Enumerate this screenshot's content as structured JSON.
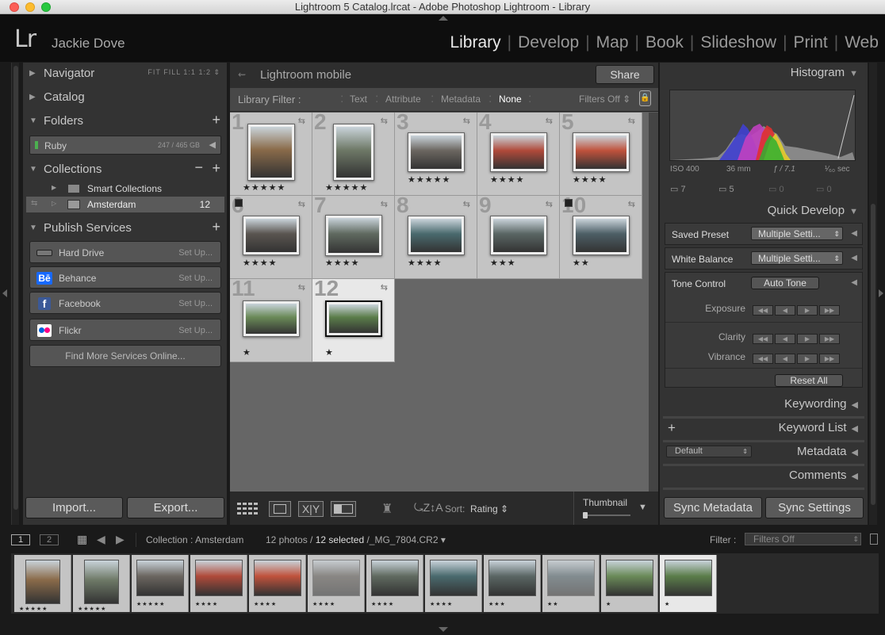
{
  "window": {
    "title": "Lightroom 5 Catalog.lrcat - Adobe Photoshop Lightroom - Library"
  },
  "identity": {
    "logo": "Lr",
    "user": "Jackie Dove"
  },
  "modules": [
    "Library",
    "Develop",
    "Map",
    "Book",
    "Slideshow",
    "Print",
    "Web"
  ],
  "left": {
    "navigator": {
      "label": "Navigator",
      "zoom": [
        "FIT",
        "FILL",
        "1:1",
        "1:2"
      ]
    },
    "catalog": {
      "label": "Catalog"
    },
    "folders": {
      "label": "Folders",
      "volume": {
        "name": "Ruby",
        "size": "247 / 465 GB"
      }
    },
    "collections": {
      "label": "Collections",
      "items": [
        {
          "name": "Smart Collections",
          "count": ""
        },
        {
          "name": "Amsterdam",
          "count": "12"
        }
      ]
    },
    "publish": {
      "label": "Publish Services",
      "services": [
        {
          "name": "Hard Drive",
          "action": "Set Up..."
        },
        {
          "name": "Behance",
          "action": "Set Up..."
        },
        {
          "name": "Facebook",
          "action": "Set Up..."
        },
        {
          "name": "Flickr",
          "action": "Set Up..."
        }
      ],
      "find_more": "Find More Services Online..."
    },
    "import_label": "Import...",
    "export_label": "Export..."
  },
  "center": {
    "mobile_label": "Lightroom mobile",
    "share_label": "Share",
    "filter": {
      "label": "Library Filter :",
      "options": [
        "Text",
        "Attribute",
        "Metadata",
        "None"
      ],
      "active": "None",
      "filters_off": "Filters Off"
    },
    "photos": [
      {
        "num": "1",
        "stars": "★★★★★",
        "color": "#8a6b4a"
      },
      {
        "num": "2",
        "stars": "★★★★★",
        "color": "#6f7a68"
      },
      {
        "num": "3",
        "stars": "★★★★★",
        "color": "#6b6660"
      },
      {
        "num": "4",
        "stars": "★★★★",
        "color": "#b04a3a"
      },
      {
        "num": "5",
        "stars": "★★★★",
        "color": "#c0523c"
      },
      {
        "num": "6",
        "stars": "★★★★",
        "color": "#5a5550"
      },
      {
        "num": "7",
        "stars": "★★★★",
        "color": "#606a60"
      },
      {
        "num": "8",
        "stars": "★★★★",
        "color": "#4a6a6e"
      },
      {
        "num": "9",
        "stars": "★★★",
        "color": "#5a6664"
      },
      {
        "num": "10",
        "stars": "★★",
        "color": "#4d5f66"
      },
      {
        "num": "11",
        "stars": "★",
        "color": "#6a8a58"
      },
      {
        "num": "12",
        "stars": "★",
        "color": "#5b7d4a"
      }
    ],
    "sort_label": "Sort:",
    "sort_value": "Rating",
    "thumbnail_label": "Thumbnail"
  },
  "right": {
    "histogram": {
      "label": "Histogram",
      "iso": "ISO 400",
      "focal": "36 mm",
      "aperture": "ƒ / 7.1",
      "shutter": "¹⁄₆₀ sec",
      "counts": [
        "7",
        "5",
        "0",
        "0"
      ]
    },
    "quick_develop": {
      "label": "Quick Develop",
      "saved_preset": {
        "label": "Saved Preset",
        "value": "Multiple Setti..."
      },
      "white_balance": {
        "label": "White Balance",
        "value": "Multiple Setti..."
      },
      "tone_control": {
        "label": "Tone Control",
        "button": "Auto Tone"
      },
      "exposure": "Exposure",
      "clarity": "Clarity",
      "vibrance": "Vibrance",
      "reset_all": "Reset All"
    },
    "keywording": "Keywording",
    "keyword_list": "Keyword List",
    "metadata": {
      "label": "Metadata",
      "preset": "Default"
    },
    "comments": "Comments",
    "sync_metadata": "Sync Metadata",
    "sync_settings": "Sync Settings"
  },
  "filmbar": {
    "page1": "1",
    "page2": "2",
    "collection": "Collection : Amsterdam",
    "count": "12 photos /",
    "selected": "12 selected",
    "file": "/_MG_7804.CR2",
    "filter_label": "Filter :",
    "filter_value": "Filters Off"
  }
}
